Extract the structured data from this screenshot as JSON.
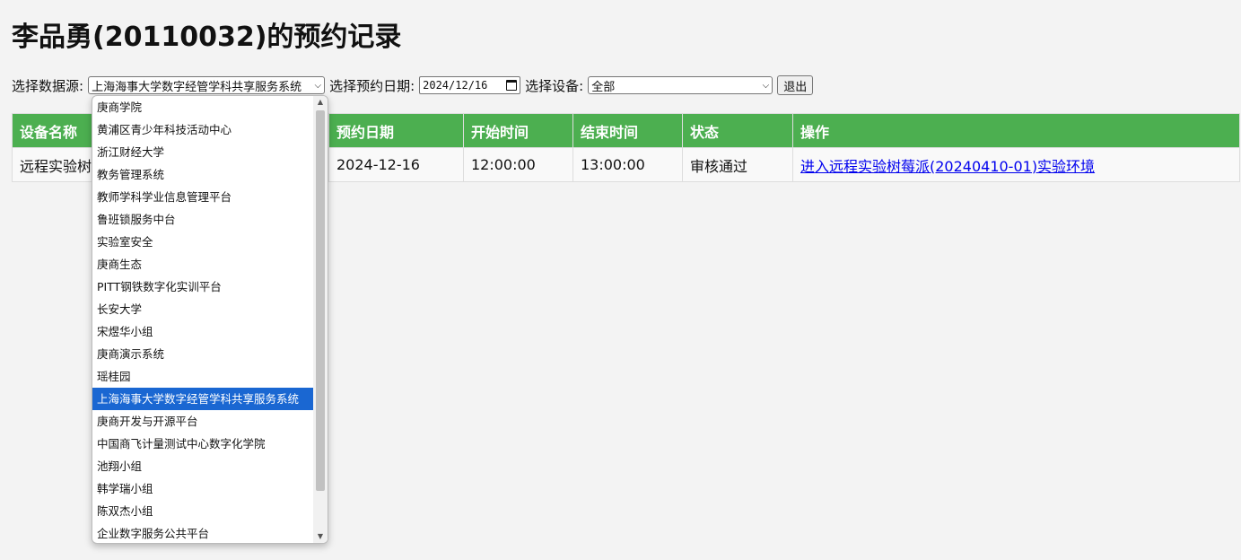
{
  "page": {
    "title": "李品勇(20110032)的预约记录"
  },
  "filters": {
    "source_label": "选择数据源:",
    "source_value": "上海海事大学数字经管学科共享服务系统",
    "date_label": "选择预约日期:",
    "date_value": "2024/12/16",
    "device_label": "选择设备:",
    "device_value": "全部",
    "logout_label": "退出"
  },
  "table": {
    "headers": [
      "设备名称",
      "",
      "预约日期",
      "开始时间",
      "结束时间",
      "状态",
      "操作"
    ],
    "rows": [
      {
        "device": "远程实验树",
        "date": "2024-12-16",
        "start": "12:00:00",
        "end": "13:00:00",
        "status": "审核通过",
        "action": "进入远程实验树莓派(20240410-01)实验环境"
      }
    ]
  },
  "dropdown": {
    "options": [
      "庚商学院",
      "黄浦区青少年科技活动中心",
      "浙江财经大学",
      "教务管理系统",
      "教师学科学业信息管理平台",
      "鲁班锁服务中台",
      "实验室安全",
      "庚商生态",
      "PITT钢铁数字化实训平台",
      "长安大学",
      "宋煜华小组",
      "庚商演示系统",
      "瑶桂园",
      "上海海事大学数字经管学科共享服务系统",
      "庚商开发与开源平台",
      "中国商飞计量测试中心数字化学院",
      "池翔小组",
      "韩学瑞小组",
      "陈双杰小组",
      "企业数字服务公共平台"
    ],
    "selected_index": 13
  },
  "colors": {
    "header_green": "#4caf50",
    "selected_blue": "#1a67d2",
    "link": "#0000ee"
  }
}
